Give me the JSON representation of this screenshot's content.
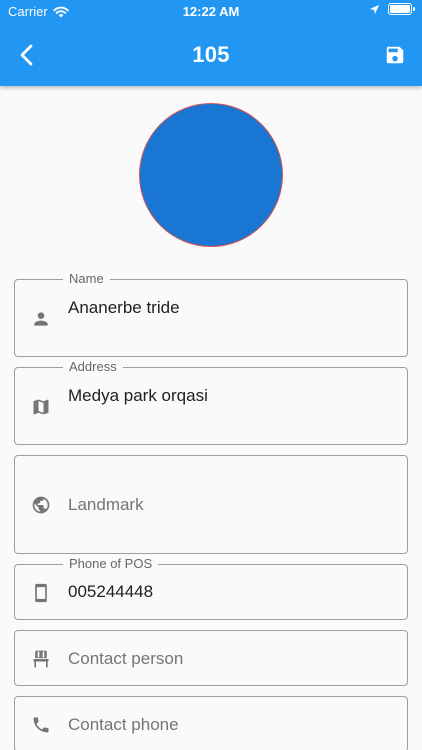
{
  "status_bar": {
    "carrier": "Carrier",
    "time": "12:22 AM"
  },
  "header": {
    "title": "105",
    "back_icon": "chevron-left-icon",
    "save_icon": "save-icon",
    "color": "#2196f3"
  },
  "avatar": {
    "color": "#1976d2"
  },
  "form": {
    "name": {
      "label": "Name",
      "value": "Ananerbe tride",
      "icon": "person-icon"
    },
    "address": {
      "label": "Address",
      "value": "Medya park orqasi",
      "icon": "map-icon"
    },
    "landmark": {
      "placeholder": "Landmark",
      "icon": "globe-icon"
    },
    "phone_pos": {
      "label": "Phone of POS",
      "value": "005244448",
      "icon": "smartphone-icon"
    },
    "contact_person": {
      "placeholder": "Contact person",
      "icon": "chair-icon"
    },
    "contact_phone": {
      "placeholder": "Contact phone",
      "icon": "phone-icon"
    }
  }
}
